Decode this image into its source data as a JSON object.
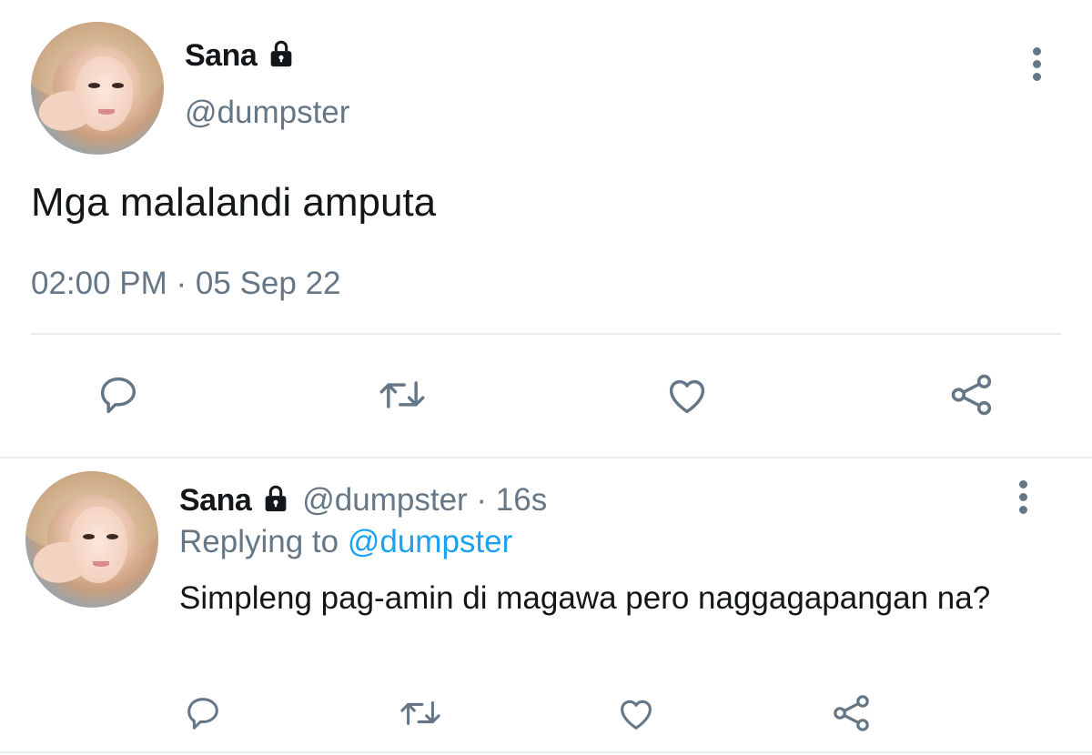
{
  "main_tweet": {
    "author_name": "Sana",
    "author_handle": "@dumpster",
    "protected_icon": "lock-icon",
    "text": "Mga malalandi amputa",
    "timestamp": "02:00 PM · 05 Sep 22",
    "actions": [
      "reply-icon",
      "retweet-icon",
      "like-icon",
      "share-icon"
    ]
  },
  "reply_tweet": {
    "author_name": "Sana",
    "author_handle_time": "@dumpster · 16s",
    "replying_prefix": "Replying to",
    "replying_mention": "@dumpster",
    "text": "Simpleng pag-amin di magawa pero naggagapangan na?",
    "actions": [
      "reply-icon",
      "retweet-icon",
      "like-icon",
      "share-icon"
    ]
  },
  "colors": {
    "text_primary": "#14171a",
    "text_secondary": "#657786",
    "mention": "#1da1f2",
    "divider": "#e6ecf0"
  }
}
